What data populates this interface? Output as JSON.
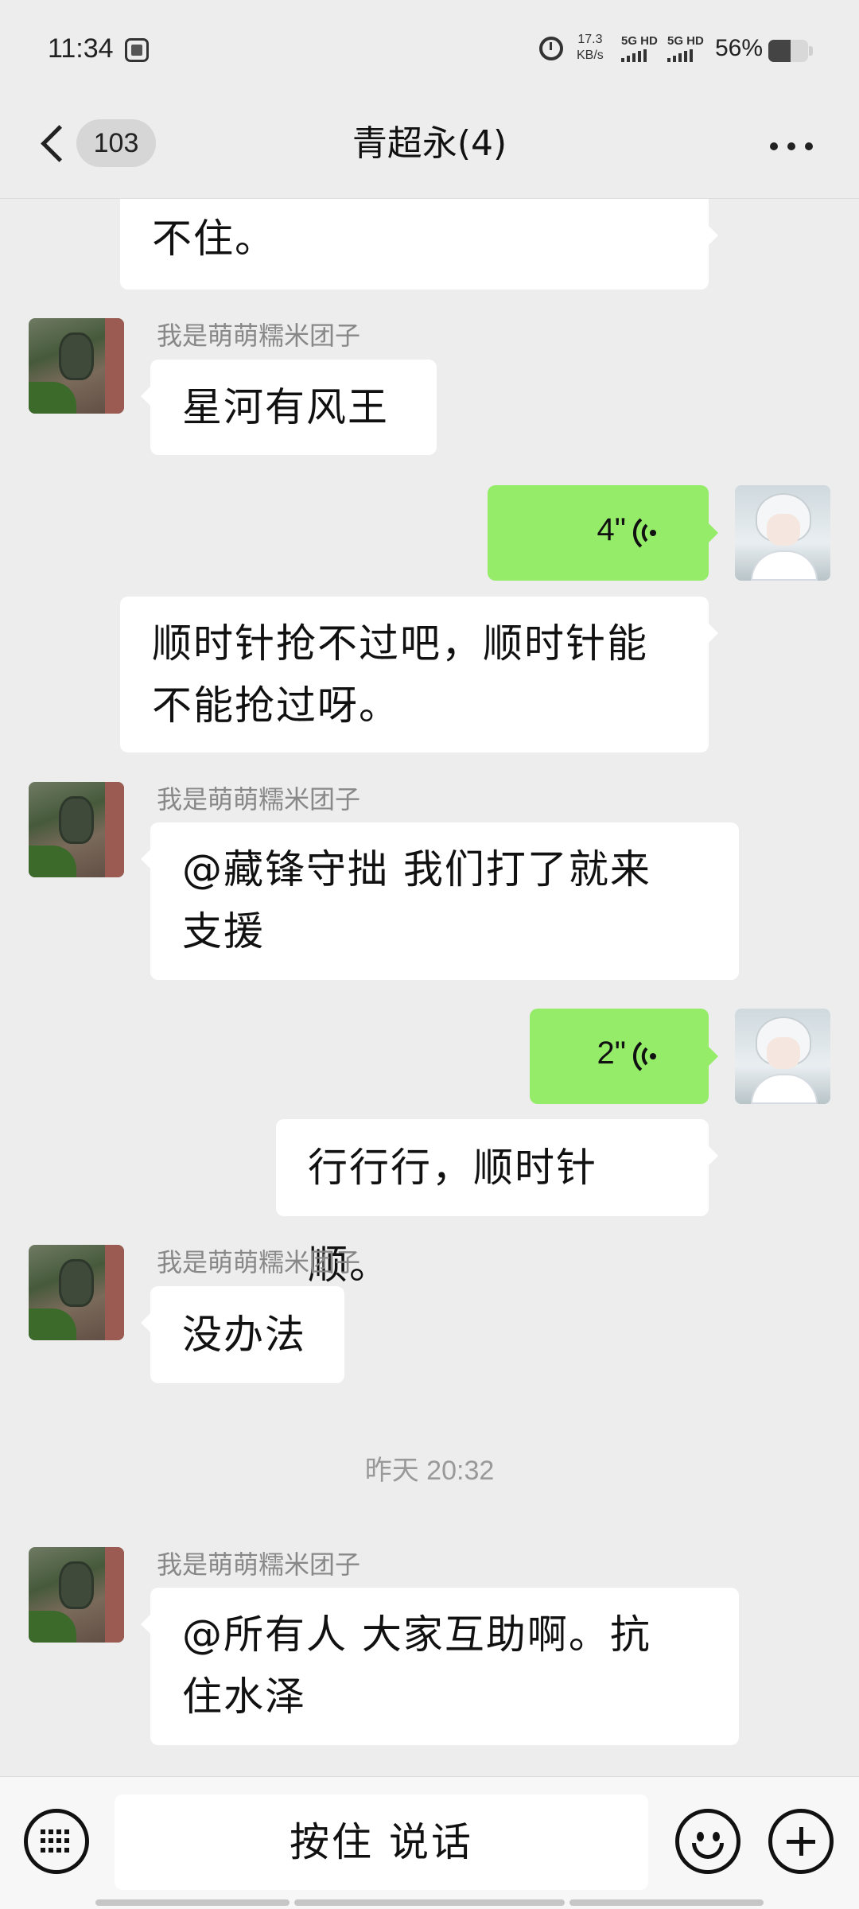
{
  "status_bar": {
    "time": "11:34",
    "net_speed_value": "17.3",
    "net_speed_unit": "KB/s",
    "sim1_label": "5G HD",
    "sim2_label": "5G HD",
    "battery_percent_label": "56%",
    "battery_level": 0.56,
    "icons": [
      "sim-icon",
      "alarm-icon",
      "signal-icon",
      "battery-icon"
    ]
  },
  "header": {
    "unread_count": "103",
    "title": "青超永(4)",
    "icons": [
      "chevron-left-icon",
      "more-icon"
    ]
  },
  "messages": [
    {
      "side": "right",
      "type": "text",
      "text": "不住。"
    },
    {
      "side": "left",
      "type": "text",
      "sender": "我是萌萌糯米团子",
      "text": "星河有风王"
    },
    {
      "side": "right",
      "type": "voice",
      "duration": "4\""
    },
    {
      "side": "right",
      "type": "text",
      "lines": [
        "顺时针抢不过吧，顺时针能",
        "不能抢过呀。"
      ]
    },
    {
      "side": "left",
      "type": "text",
      "sender": "我是萌萌糯米团子",
      "lines": [
        "@藏锋守拙 我们打了就来",
        "支援"
      ]
    },
    {
      "side": "right",
      "type": "voice",
      "duration": "2\""
    },
    {
      "side": "right",
      "type": "text",
      "text": "行行行，顺时针顺。"
    },
    {
      "side": "left",
      "type": "text",
      "sender": "我是萌萌糯米团子",
      "text": "没办法"
    },
    {
      "type": "time",
      "text": "昨天 20:32"
    },
    {
      "side": "left",
      "type": "text",
      "sender": "我是萌萌糯米团子",
      "lines": [
        "@所有人 大家互助啊。抗",
        "住水泽"
      ]
    }
  ],
  "input_bar": {
    "hold_to_talk_label": "按住 说话",
    "icons": [
      "keyboard-icon",
      "emoji-icon",
      "plus-icon"
    ]
  },
  "colors": {
    "background": "#ededed",
    "voice_bubble": "#95ec69",
    "text_bubble": "#ffffff"
  }
}
